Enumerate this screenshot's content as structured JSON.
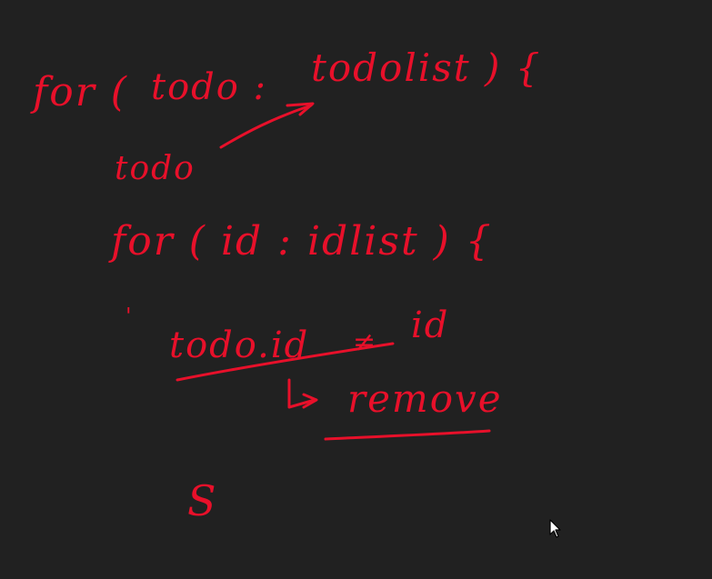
{
  "colors": {
    "ink": "#e8102a",
    "background": "#212121",
    "cursor_fill": "#ffffff",
    "cursor_outline": "#000000"
  },
  "notes": {
    "line1_for": "for (",
    "line1_todo": "todo :",
    "line1_todolist": "todolist ) {",
    "line2_todo": "todo",
    "line3": "for ( id :  idlist ) {",
    "line4_mark": "'",
    "line5_todoid": "todo.id",
    "line5_ne": "≠",
    "line5_id": "id",
    "line6_remove": "remove",
    "line7_close": "S"
  },
  "cursor": {
    "icon": "arrow-pointer-icon"
  }
}
